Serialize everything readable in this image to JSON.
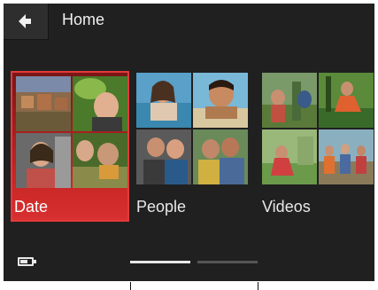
{
  "header": {
    "title": "Home"
  },
  "categories": [
    {
      "label": "Date",
      "selected": true
    },
    {
      "label": "People",
      "selected": false
    },
    {
      "label": "Videos",
      "selected": false
    }
  ],
  "status": {
    "battery_icon": "battery-icon",
    "page_count": 2,
    "current_page": 1
  },
  "colors": {
    "accent": "#d62a2a",
    "background": "#202020",
    "text": "#f0f0f0"
  }
}
